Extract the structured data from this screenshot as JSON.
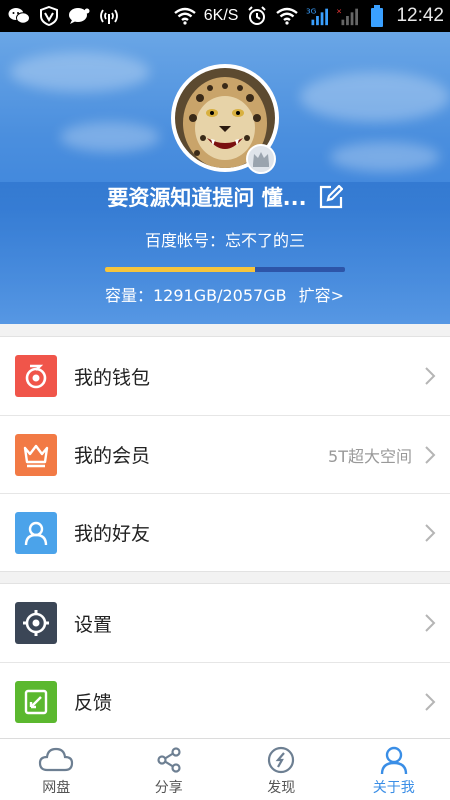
{
  "status_bar": {
    "network_speed": "6K/S",
    "signal_type": "3G",
    "time": "12:42",
    "icons": [
      "wechat-icon",
      "vpn-shield-icon",
      "chat-bubble-icon",
      "signal-broadcast-icon",
      "wifi-icon",
      "alarm-icon",
      "wifi-icon",
      "cell-signal-icon",
      "battery-icon"
    ]
  },
  "profile": {
    "username": "要资源知道提问 懂...",
    "account_label": "百度帐号：忘不了的三",
    "storage_used_fraction": 0.627,
    "capacity_text": "容量：1291GB/2057GB",
    "expand_link": "扩容>"
  },
  "menu_group_1": [
    {
      "label": "我的钱包",
      "icon": "wallet-icon",
      "color": "#f0554a",
      "extra": ""
    },
    {
      "label": "我的会员",
      "icon": "crown-icon",
      "color": "#f27a45",
      "extra": "5T超大空间"
    },
    {
      "label": "我的好友",
      "icon": "friend-icon",
      "color": "#4ba3ea",
      "extra": ""
    }
  ],
  "menu_group_2": [
    {
      "label": "设置",
      "icon": "settings-icon",
      "color": "#3b4656",
      "extra": ""
    },
    {
      "label": "反馈",
      "icon": "feedback-icon",
      "color": "#5bb82f",
      "extra": ""
    }
  ],
  "tabs": [
    {
      "label": "网盘",
      "icon": "cloud-icon",
      "active": false
    },
    {
      "label": "分享",
      "icon": "share-icon",
      "active": false
    },
    {
      "label": "发现",
      "icon": "compass-icon",
      "active": false
    },
    {
      "label": "关于我",
      "icon": "person-icon",
      "active": true
    }
  ],
  "colors": {
    "accent": "#3a8ee6",
    "progress_fill": "#f6c53c",
    "progress_track": "#2d55a8"
  }
}
